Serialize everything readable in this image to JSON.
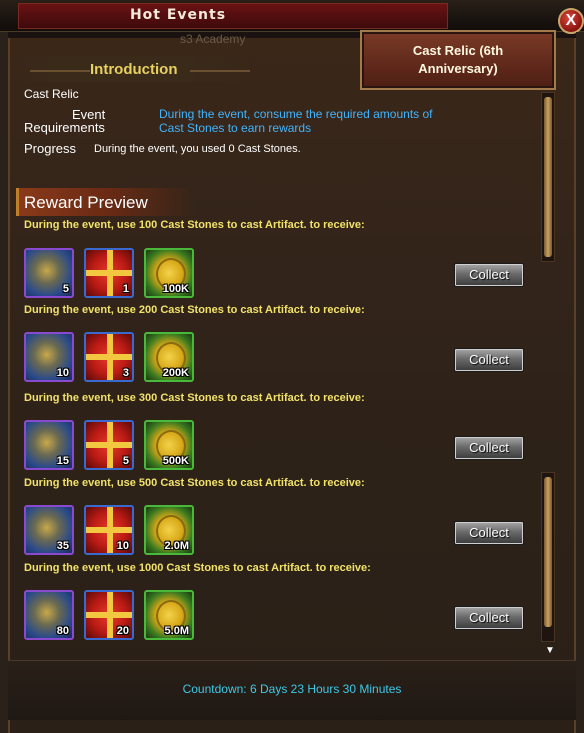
{
  "window": {
    "title": "Hot Events",
    "close_symbol": "X",
    "behind_text": "s3 Academy"
  },
  "event_tab": {
    "label_line1": "Cast Relic (6th",
    "label_line2": "Anniversary)"
  },
  "intro": {
    "heading": "Introduction",
    "event_name": "Cast Relic",
    "requirements_label_1": "Event",
    "requirements_label_2": "Requirements",
    "requirements_text_1": "During the event, consume the required amounts of",
    "requirements_text_2": "Cast Stones to earn rewards",
    "progress_label": "Progress",
    "progress_text": "During the event, you used 0 Cast Stones."
  },
  "reward_preview": {
    "heading": "Reward Preview",
    "collect_label": "Collect",
    "tiers": [
      {
        "text": "During the event, use 100 Cast Stones to cast Artifact. to receive:",
        "stone_qty": "5",
        "gift_qty": "1",
        "coin_qty": "100K"
      },
      {
        "text": "During the event, use 200 Cast Stones to cast Artifact. to receive:",
        "stone_qty": "10",
        "gift_qty": "3",
        "coin_qty": "200K"
      },
      {
        "text": "During the event, use 300 Cast Stones to cast Artifact. to receive:",
        "stone_qty": "15",
        "gift_qty": "5",
        "coin_qty": "500K"
      },
      {
        "text": "During the event, use 500 Cast Stones to cast Artifact. to receive:",
        "stone_qty": "35",
        "gift_qty": "10",
        "coin_qty": "2.0M"
      },
      {
        "text": "During the event, use 1000 Cast Stones to cast Artifact. to receive:",
        "stone_qty": "80",
        "gift_qty": "20",
        "coin_qty": "5.0M"
      }
    ]
  },
  "scroll_down_symbol": "▼",
  "footer": {
    "countdown": "Countdown: 6 Days 23 Hours 30 Minutes"
  },
  "colors": {
    "accent_gold": "#e8d060",
    "link_blue": "#3fb4ff",
    "tier_yellow": "#f2e26a",
    "countdown_cyan": "#3fc8e8"
  }
}
